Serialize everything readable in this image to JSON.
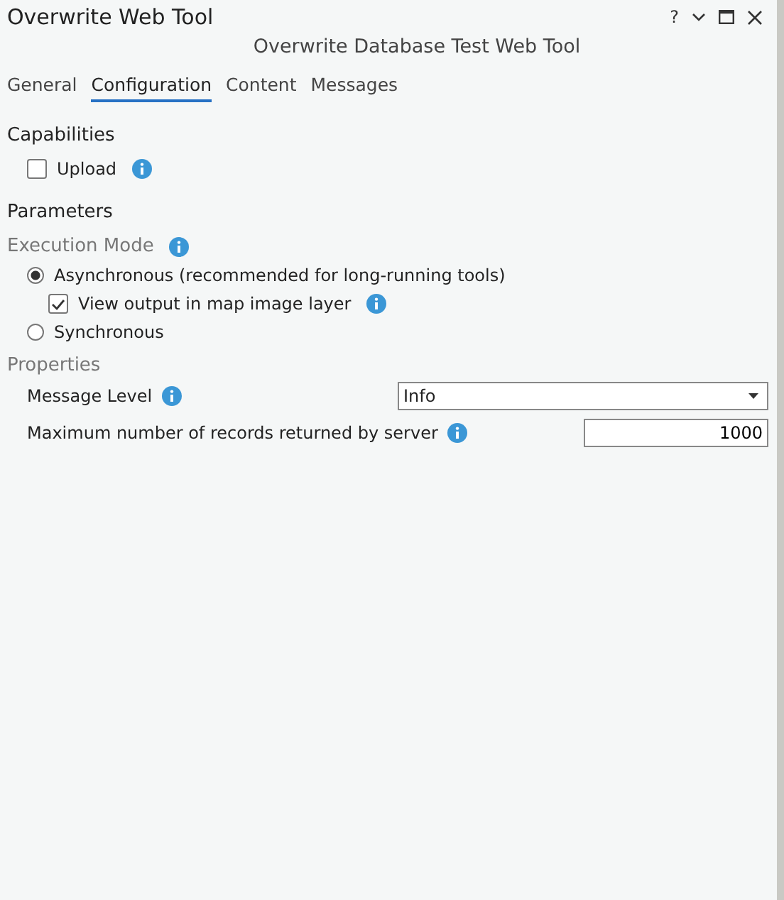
{
  "window": {
    "title": "Overwrite Web Tool",
    "help": "?"
  },
  "subtitle": "Overwrite Database Test Web Tool",
  "tabs": [
    {
      "label": "General",
      "selected": false
    },
    {
      "label": "Configuration",
      "selected": true
    },
    {
      "label": "Content",
      "selected": false
    },
    {
      "label": "Messages",
      "selected": false
    }
  ],
  "capabilities": {
    "heading": "Capabilities",
    "items": [
      {
        "label": "Upload",
        "checked": false
      }
    ]
  },
  "parameters": {
    "heading": "Parameters",
    "execution_mode": {
      "label": "Execution Mode",
      "options": [
        {
          "label": "Asynchronous (recommended for long-running tools)",
          "selected": true,
          "sub": {
            "label": "View output in map image layer",
            "checked": true
          }
        },
        {
          "label": "Synchronous",
          "selected": false
        }
      ]
    }
  },
  "properties": {
    "heading": "Properties",
    "message_level": {
      "label": "Message Level",
      "value": "Info"
    },
    "max_records": {
      "label": "Maximum number of records returned by server",
      "value": "1000"
    }
  }
}
